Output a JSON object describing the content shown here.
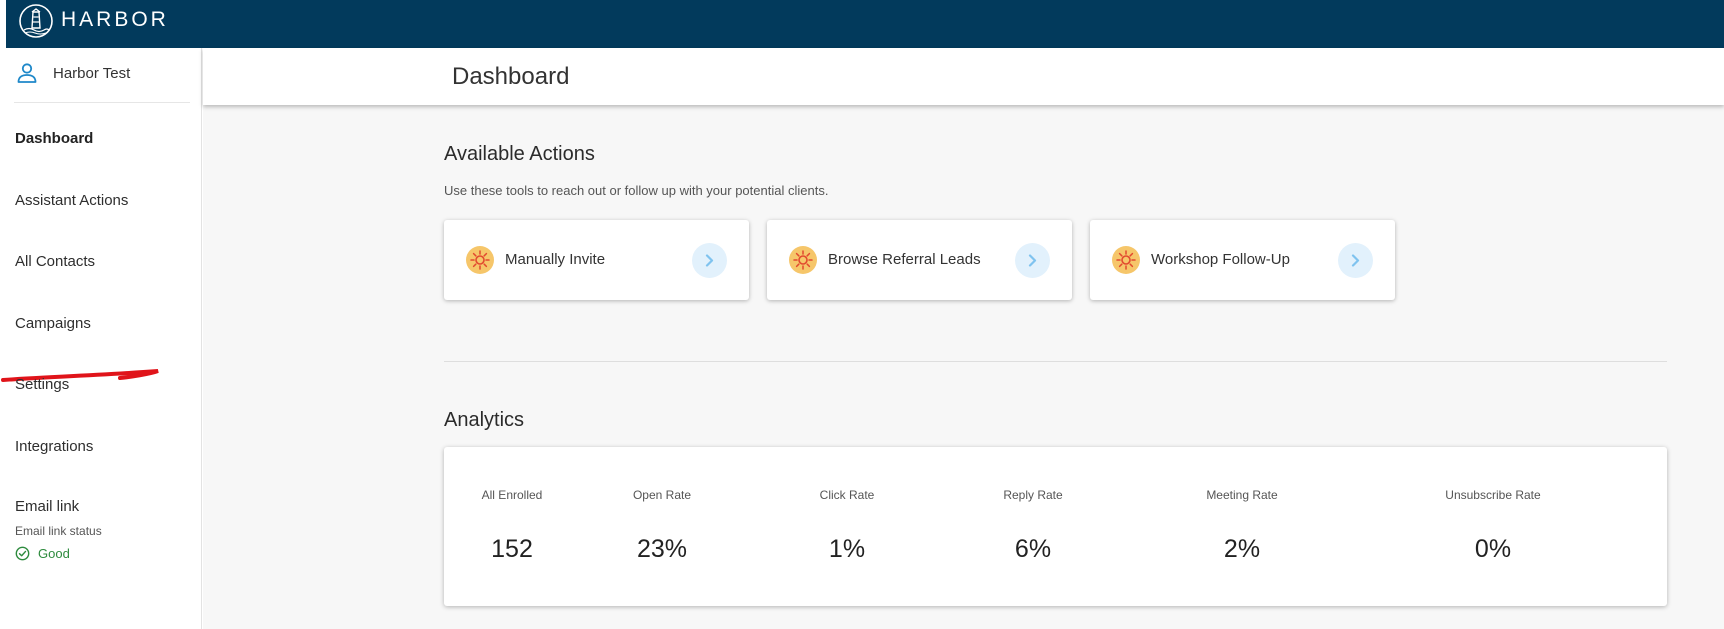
{
  "header": {
    "brand": "HARBOR"
  },
  "sidebar": {
    "user_name": "Harbor Test",
    "items": [
      {
        "label": "Dashboard",
        "active": true
      },
      {
        "label": "Assistant Actions"
      },
      {
        "label": "All Contacts"
      },
      {
        "label": "Campaigns"
      },
      {
        "label": "Settings"
      },
      {
        "label": "Integrations"
      },
      {
        "label": "Email link"
      }
    ],
    "email_link_status_label": "Email link status",
    "email_link_status": "Good"
  },
  "main": {
    "page_title": "Dashboard",
    "actions": {
      "title": "Available Actions",
      "subtitle": "Use these tools to reach out or follow up with your potential clients.",
      "cards": [
        {
          "label": "Manually Invite",
          "icon": "sun-icon"
        },
        {
          "label": "Browse Referral Leads",
          "icon": "sun-icon"
        },
        {
          "label": "Workshop Follow-Up",
          "icon": "sun-icon"
        }
      ]
    },
    "analytics": {
      "title": "Analytics",
      "metrics": [
        {
          "label": "All Enrolled",
          "value": "152"
        },
        {
          "label": "Open Rate",
          "value": "23%"
        },
        {
          "label": "Click Rate",
          "value": "1%"
        },
        {
          "label": "Reply Rate",
          "value": "6%"
        },
        {
          "label": "Meeting Rate",
          "value": "2%"
        },
        {
          "label": "Unsubscribe Rate",
          "value": "0%"
        }
      ]
    }
  },
  "colors": {
    "topbar": "#023a5c",
    "accent_blue": "#1e88c9",
    "good_green": "#2e8b3e",
    "annotation_red": "#e0141a",
    "arrow_bg": "#e2f1fc",
    "sun_bg": "#f6c66a"
  }
}
